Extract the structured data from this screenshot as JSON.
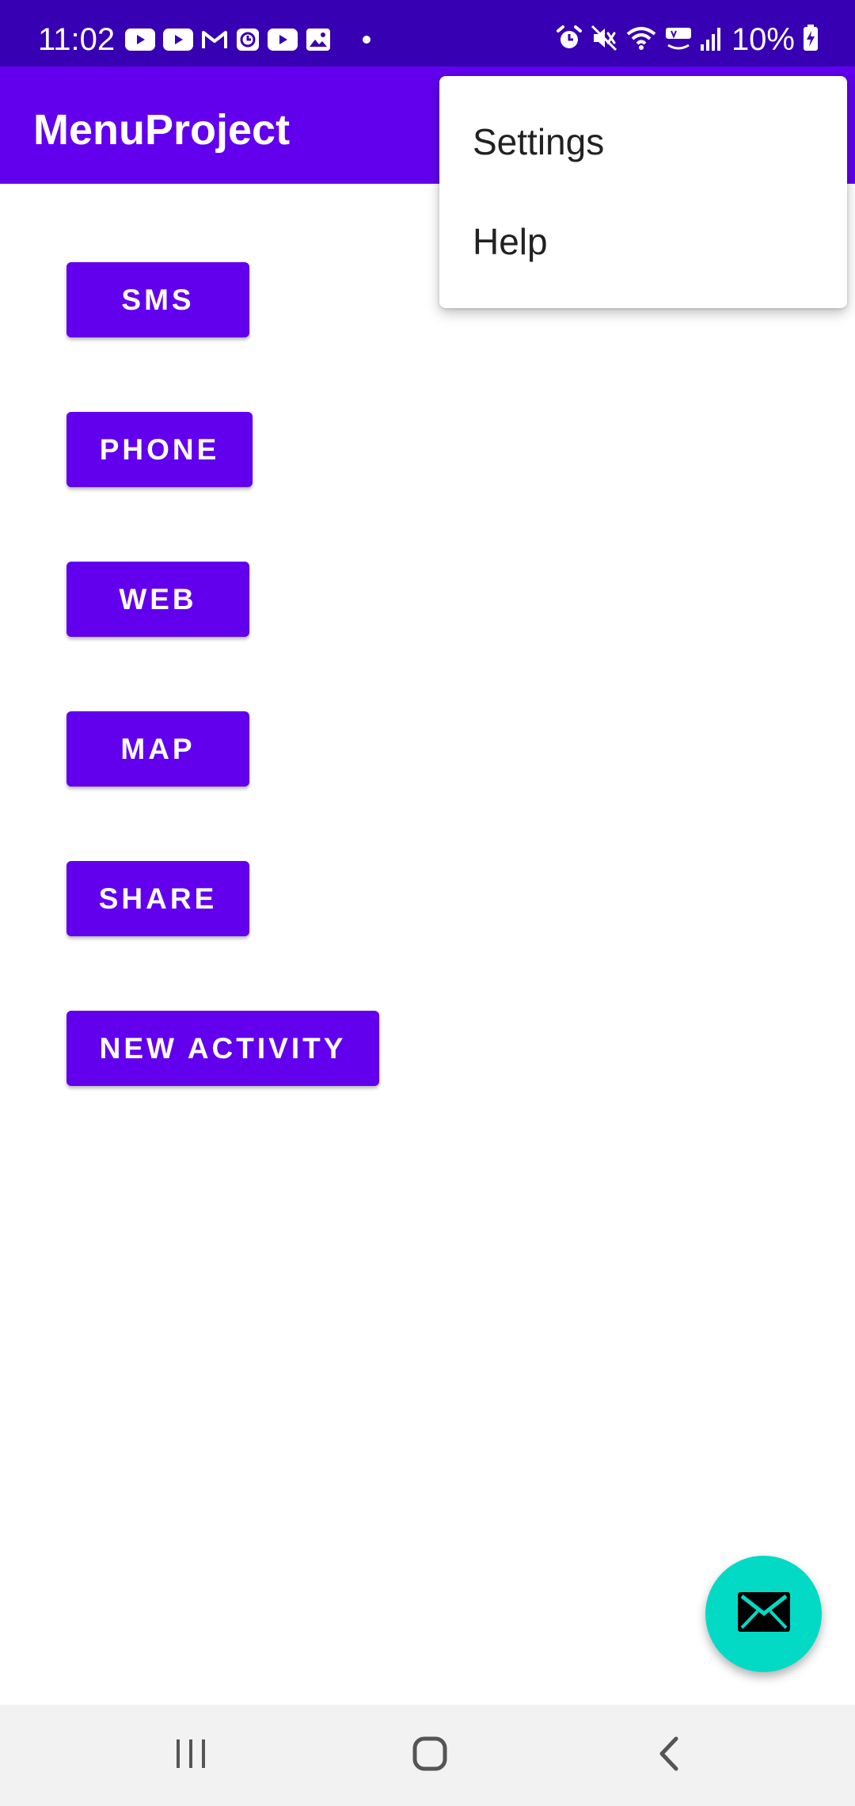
{
  "status_bar": {
    "time": "11:02",
    "battery_text": "10%",
    "left_icons": [
      "youtube-icon",
      "youtube-icon",
      "gmail-icon",
      "clock-app-icon",
      "youtube-icon",
      "gallery-icon",
      "more-notifications-dot-icon"
    ],
    "right_icons": [
      "alarm-icon",
      "mute-icon",
      "wifi-icon",
      "volte-icon",
      "signal-icon",
      "battery-charging-icon"
    ]
  },
  "app_bar": {
    "title": "MenuProject",
    "color": "#6200ee"
  },
  "buttons": [
    {
      "label": "SMS"
    },
    {
      "label": "PHONE"
    },
    {
      "label": "WEB"
    },
    {
      "label": "MAP"
    },
    {
      "label": "SHARE"
    },
    {
      "label": "NEW ACTIVITY"
    }
  ],
  "overflow_menu": {
    "items": [
      {
        "label": "Settings"
      },
      {
        "label": "Help"
      }
    ]
  },
  "fab": {
    "icon": "email-icon",
    "color": "#03dac5"
  },
  "nav_bar": {
    "items": [
      "recent-apps-icon",
      "home-icon",
      "back-icon"
    ]
  },
  "colors": {
    "status_bar": "#3700b3",
    "primary": "#6200ee",
    "accent": "#03dac5"
  }
}
